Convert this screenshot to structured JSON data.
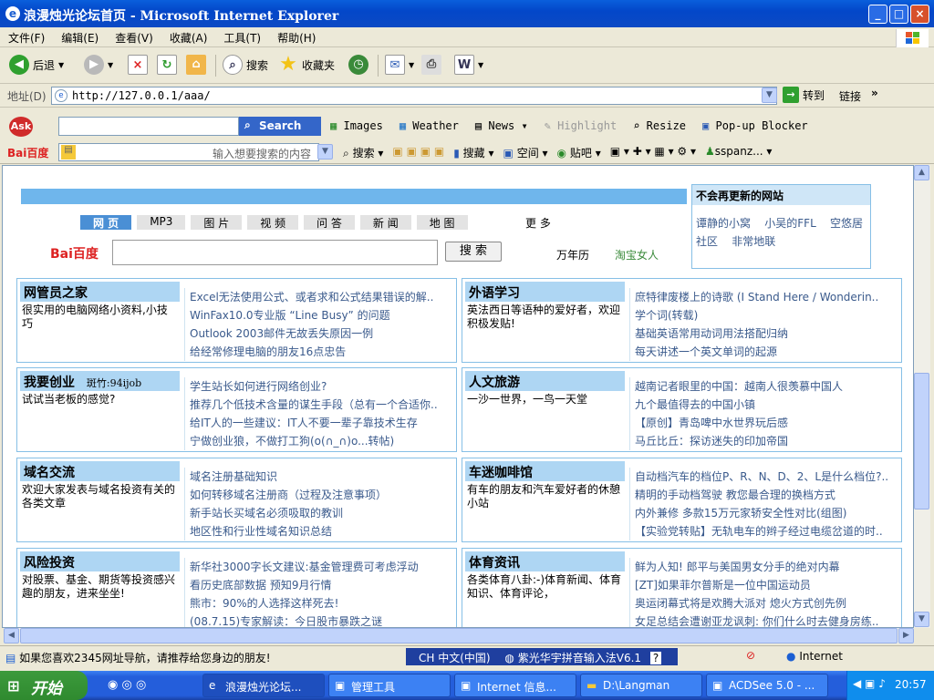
{
  "window": {
    "title": "浪漫烛光论坛首页 - Microsoft Internet Explorer",
    "min": "_",
    "max": "□",
    "close": "×"
  },
  "menu": [
    "文件(F)",
    "编辑(E)",
    "查看(V)",
    "收藏(A)",
    "工具(T)",
    "帮助(H)"
  ],
  "toolbar": {
    "back": "后退",
    "search": "搜索",
    "favorites": "收藏夹"
  },
  "address": {
    "label": "地址(D)",
    "url": "http://127.0.0.1/aaa/",
    "go": "转到",
    "links": "链接"
  },
  "ask": {
    "logo": "Ask",
    "search_btn": "Search",
    "images": "Images",
    "weather": "Weather",
    "news": "News",
    "highlight": "Highlight",
    "resize": "Resize",
    "popup": "Pop-up Blocker"
  },
  "baidu": {
    "logo": "Bai百度",
    "placeholder": "输入想要搜索的内容",
    "search": "搜索",
    "favorites": "搜藏",
    "space": "空间",
    "post": "贴吧",
    "user": "sspanz..."
  },
  "page": {
    "tabs": [
      "网 页",
      "MP3",
      "图 片",
      "视 频",
      "问 答",
      "新 闻",
      "地 图",
      "更 多"
    ],
    "baidu_logo": "Bai百度",
    "search_button": "搜 索",
    "side_links": [
      "万年历",
      "淘宝女人"
    ],
    "nonupdate": {
      "title": "不会再更新的网站",
      "links": [
        "谭静的小窝",
        "小吴的FFL",
        "空悠居",
        "社区",
        "非常地联"
      ]
    },
    "sections": [
      {
        "title": "网管员之家",
        "extra": "",
        "desc": "很实用的电脑网络小资料,小技巧",
        "items": [
          "Excel无法使用公式、或者求和公式结果错误的解..",
          "WinFax10.0专业版 “Line Busy” 的问题",
          "Outlook 2003邮件无故丢失原因一例",
          "给经常修理电脑的朋友16点忠告"
        ]
      },
      {
        "title": "外语学习",
        "extra": "",
        "desc": "英法西日等语种的爱好者，欢迎积极发贴!",
        "items": [
          "庶特律废楼上的诗歌 (I Stand Here / Wonderin..",
          "学个词(转载)",
          "基础英语常用动词用法搭配归纳",
          "每天讲述一个英文单词的起源"
        ]
      },
      {
        "title": "我要创业",
        "extra": "斑竹:94ijob",
        "desc": "试试当老板的感觉?",
        "items": [
          "学生站长如何进行网络创业?",
          "推荐几个低技术含量的谋生手段（总有一个合适你..",
          "给IT人的一些建议：IT人不要一辈子靠技术生存",
          "宁做创业狼，不做打工狗(o(∩_∩)o...转帖)"
        ]
      },
      {
        "title": "人文旅游",
        "extra": "",
        "desc": "一沙一世界，一鸟一天堂",
        "items": [
          "越南记者眼里的中国：越南人很羡慕中国人",
          "九个最值得去的中国小镇",
          "【原创】青岛啤中水世界玩后感",
          "马丘比丘：探访迷失的印加帝国"
        ]
      },
      {
        "title": "域名交流",
        "extra": "",
        "desc": "欢迎大家发表与域名投资有关的各类文章",
        "items": [
          "域名注册基础知识",
          "如何转移域名注册商（过程及注意事项）",
          "新手站长买域名必须吸取的教训",
          "地区性和行业性域名知识总结"
        ]
      },
      {
        "title": "车迷咖啡馆",
        "extra": "",
        "desc": "有车的朋友和汽车爱好者的休憩小站",
        "items": [
          "自动档汽车的档位P、R、N、D、2、L是什么档位?..",
          "精明的手动档驾驶 教您最合理的换档方式",
          "内外兼修 多款15万元家轿安全性对比(组图)",
          "【实验党转贴】无轨电车的辫子经过电缆岔道的时.."
        ]
      },
      {
        "title": "风险投资",
        "extra": "",
        "desc": "对股票、基金、期货等投资感兴趣的朋友，进来坐坐!",
        "items": [
          "新华社3000字长文建议:基金管理费可考虑浮动",
          "看历史底部数据 预知9月行情",
          "熊市：90%的人选择这样死去!",
          "(08.7.15)专家解读：今日股市暴跌之谜"
        ]
      },
      {
        "title": "体育资讯",
        "extra": "",
        "desc": "各类体育八卦:-)体育新闻、体育知识、体育评论，",
        "items": [
          "鲜为人知! 郎平与美国男女分手的绝对内幕",
          "[ZT]如果菲尔普斯是一位中国运动员",
          "奥运闭幕式将是欢腾大派对 熄火方式创先例",
          "女足总结会遭谢亚龙讽刺: 你们什么时去健身房练.."
        ]
      }
    ]
  },
  "status": {
    "text": "如果您喜欢2345网址导航，请推荐给您身边的朋友!",
    "ime": "CH 中文(中国)",
    "ime2": "紫光华宇拼音输入法V6.1",
    "zone": "Internet"
  },
  "taskbar": {
    "start": "开始",
    "tasks": [
      "浪漫烛光论坛...",
      "管理工具",
      "Internet 信息...",
      "D:\\Langman",
      "ACDSee 5.0 - ..."
    ],
    "time": "20:57"
  }
}
